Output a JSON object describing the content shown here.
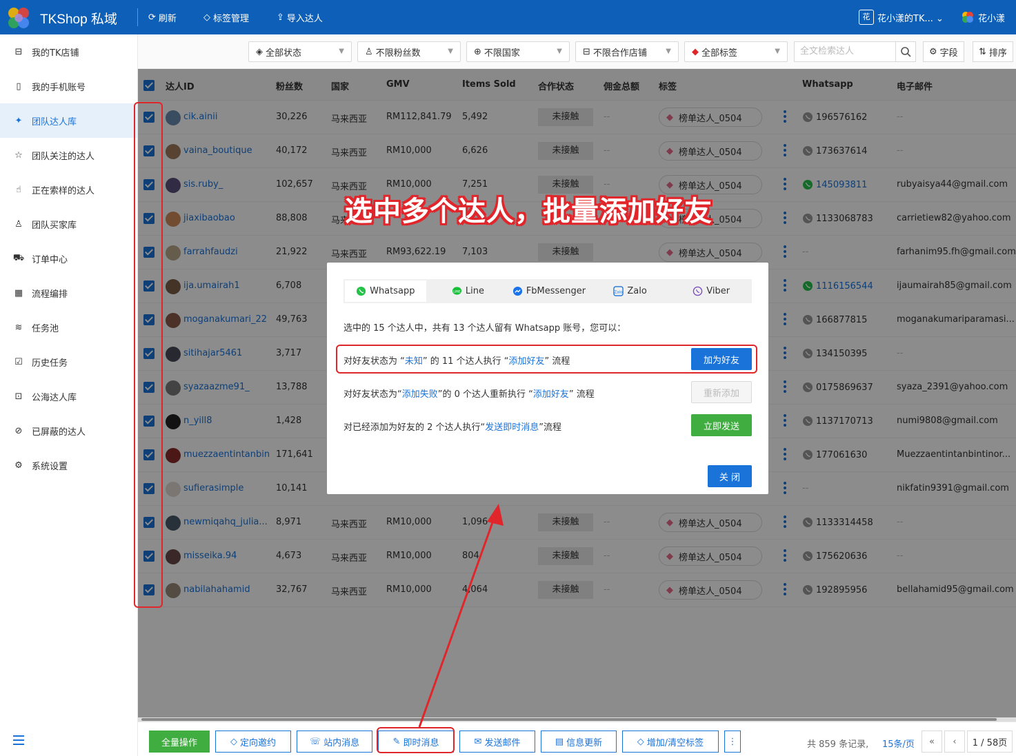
{
  "app": {
    "brand": "TKShop 私域"
  },
  "topnav": {
    "refresh": "刷新",
    "tags": "标签管理",
    "import": "导入达人"
  },
  "workspace": {
    "icon_text": "花",
    "name": "花小漾的TK..."
  },
  "user": {
    "name": "花小漾"
  },
  "sidebar": {
    "items": [
      {
        "label": "我的TK店铺",
        "icon": "shop-icon"
      },
      {
        "label": "我的手机账号",
        "icon": "phone-icon"
      },
      {
        "label": "团队达人库",
        "icon": "team-creators-icon"
      },
      {
        "label": "团队关注的达人",
        "icon": "star-icon"
      },
      {
        "label": "正在索样的达人",
        "icon": "hand-icon"
      },
      {
        "label": "团队买家库",
        "icon": "buyer-icon"
      },
      {
        "label": "订单中心",
        "icon": "truck-icon"
      },
      {
        "label": "流程编排",
        "icon": "calendar-icon"
      },
      {
        "label": "任务池",
        "icon": "layers-icon"
      },
      {
        "label": "历史任务",
        "icon": "clipboard-icon"
      },
      {
        "label": "公海达人库",
        "icon": "public-icon"
      },
      {
        "label": "已屏蔽的达人",
        "icon": "block-icon"
      },
      {
        "label": "系统设置",
        "icon": "gear-icon"
      }
    ]
  },
  "filters": {
    "status": "全部状态",
    "fans": "不限粉丝数",
    "country": "不限国家",
    "shop": "不限合作店铺",
    "tags": "全部标签",
    "search_placeholder": "全文检索达人",
    "fields": "字段",
    "sort": "排序"
  },
  "table": {
    "headers": {
      "id": "达人ID",
      "fans": "粉丝数",
      "country": "国家",
      "gmv": "GMV",
      "items": "Items Sold",
      "coop": "合作状态",
      "commission": "佣金总额",
      "tags": "标签",
      "whatsapp": "Whatsapp",
      "email": "电子邮件"
    },
    "rows": [
      {
        "id": "cik.ainii",
        "fans": "30,226",
        "country": "马来西亚",
        "gmv": "RM112,841.79",
        "items": "5,492",
        "status": "未接触",
        "commission": "--",
        "tag": "榜单达人_0504",
        "whatsapp": "196576162",
        "wa_active": false,
        "email": "--",
        "av": "#6a8caf"
      },
      {
        "id": "vaina_boutique",
        "fans": "40,172",
        "country": "马来西亚",
        "gmv": "RM10,000",
        "items": "6,626",
        "status": "未接触",
        "commission": "--",
        "tag": "榜单达人_0504",
        "whatsapp": "173637614",
        "wa_active": false,
        "email": "--",
        "av": "#a0785a"
      },
      {
        "id": "sis.ruby_",
        "fans": "102,657",
        "country": "马来西亚",
        "gmv": "RM10,000",
        "items": "7,251",
        "status": "未接触",
        "commission": "--",
        "tag": "榜单达人_0504",
        "whatsapp": "145093811",
        "wa_active": true,
        "email": "rubyaisya44@gmail.com",
        "av": "#5a4f7a"
      },
      {
        "id": "jiaxibaobao",
        "fans": "88,808",
        "country": "马来西亚",
        "gmv": "",
        "items": "",
        "status": "",
        "commission": "",
        "tag": "榜单达人_0504",
        "whatsapp": "1133068783",
        "wa_active": false,
        "email": "carrietiew82@yahoo.com",
        "av": "#d08a5a"
      },
      {
        "id": "farrahfaudzi",
        "fans": "21,922",
        "country": "马来西亚",
        "gmv": "RM93,622.19",
        "items": "7,103",
        "status": "未接触",
        "commission": "",
        "tag": "榜单达人_0504",
        "whatsapp": "--",
        "wa_active": false,
        "email": "farhanim95.fh@gmail.com",
        "av": "#b9a88a"
      },
      {
        "id": "ija.umairah1",
        "fans": "6,708",
        "country": "",
        "gmv": "",
        "items": "",
        "status": "",
        "commission": "",
        "tag": "",
        "whatsapp": "1116156544",
        "wa_active": true,
        "email": "ijaumairah85@gmail.com",
        "av": "#7a6048"
      },
      {
        "id": "moganakumari_22",
        "fans": "49,763",
        "country": "",
        "gmv": "",
        "items": "",
        "status": "",
        "commission": "",
        "tag": "",
        "whatsapp": "166877815",
        "wa_active": false,
        "email": "moganakumariparamasi...",
        "av": "#8a5a4a"
      },
      {
        "id": "sitihajar5461",
        "fans": "3,717",
        "country": "",
        "gmv": "",
        "items": "",
        "status": "",
        "commission": "",
        "tag": "",
        "whatsapp": "134150395",
        "wa_active": false,
        "email": "--",
        "av": "#4a4a5a"
      },
      {
        "id": "syazaazme91_",
        "fans": "13,788",
        "country": "",
        "gmv": "",
        "items": "",
        "status": "",
        "commission": "",
        "tag": "",
        "whatsapp": "0175869637",
        "wa_active": false,
        "email": "syaza_2391@yahoo.com",
        "av": "#7a7a7a"
      },
      {
        "id": "n_yill8",
        "fans": "1,428",
        "country": "",
        "gmv": "",
        "items": "",
        "status": "",
        "commission": "",
        "tag": "",
        "whatsapp": "1137170713",
        "wa_active": false,
        "email": "numi9808@gmail.com",
        "av": "#222222"
      },
      {
        "id": "muezzaentintanbin",
        "fans": "171,641",
        "country": "",
        "gmv": "",
        "items": "",
        "status": "",
        "commission": "",
        "tag": "",
        "whatsapp": "177061630",
        "wa_active": false,
        "email": "Muezzaentintanbintinor...",
        "av": "#8a2a2a"
      },
      {
        "id": "sufierasimple",
        "fans": "10,141",
        "country": "",
        "gmv": "",
        "items": "",
        "status": "",
        "commission": "",
        "tag": "",
        "whatsapp": "--",
        "wa_active": false,
        "email": "nikfatin9391@gmail.com",
        "av": "#e0d8d0"
      },
      {
        "id": "newmiqahq_julia...",
        "fans": "8,971",
        "country": "马来西亚",
        "gmv": "RM10,000",
        "items": "1,096",
        "status": "未接触",
        "commission": "--",
        "tag": "榜单达人_0504",
        "whatsapp": "1133314458",
        "wa_active": false,
        "email": "--",
        "av": "#4a5a6a"
      },
      {
        "id": "misseika.94",
        "fans": "4,673",
        "country": "马来西亚",
        "gmv": "RM10,000",
        "items": "804",
        "status": "未接触",
        "commission": "--",
        "tag": "榜单达人_0504",
        "whatsapp": "175620636",
        "wa_active": false,
        "email": "--",
        "av": "#6a4a4a"
      },
      {
        "id": "nabilahahamid",
        "fans": "32,767",
        "country": "马来西亚",
        "gmv": "RM10,000",
        "items": "4,064",
        "status": "未接触",
        "commission": "--",
        "tag": "榜单达人_0504",
        "whatsapp": "192895956",
        "wa_active": false,
        "email": "bellahamid95@gmail.com",
        "av": "#9a8a7a"
      }
    ]
  },
  "bottombar": {
    "all_ops": "全量操作",
    "invite": "定向邀约",
    "site_msg": "站内消息",
    "instant_msg": "即时消息",
    "email": "发送邮件",
    "update": "信息更新",
    "tags": "增加/清空标签",
    "total": "共 859 条记录,",
    "page_size": "15条/页",
    "page": "1 / 58页"
  },
  "callout": "选中多个达人，批量添加好友",
  "modal": {
    "tabs": [
      "Whatsapp",
      "Line",
      "FbMessenger",
      "Zalo",
      "Viber"
    ],
    "summary": "选中的 15 个达人中，共有 13 个达人留有 Whatsapp 账号，您可以：",
    "line1": {
      "a": "对好友状态为 “",
      "b": "未知",
      "c": "” 的 11 个达人执行 “",
      "d": "添加好友",
      "e": "” 流程",
      "btn": "加为好友"
    },
    "line2": {
      "a": "对好友状态为“",
      "b": "添加失败",
      "c": "”的 0 个达人重新执行 “",
      "d": "添加好友",
      "e": "” 流程",
      "btn": "重新添加"
    },
    "line3": {
      "a": "对已经添加为好友的 2 个达人执行“",
      "b": "发送即时消息",
      "c": "”流程",
      "btn": "立即发送"
    },
    "close": "关 闭"
  },
  "colors": {
    "primary": "#1a73d9",
    "topbar": "#0e5fb7",
    "green": "#3fad3f",
    "annotation_red": "#e0262b",
    "whatsapp": "#25c24a"
  }
}
